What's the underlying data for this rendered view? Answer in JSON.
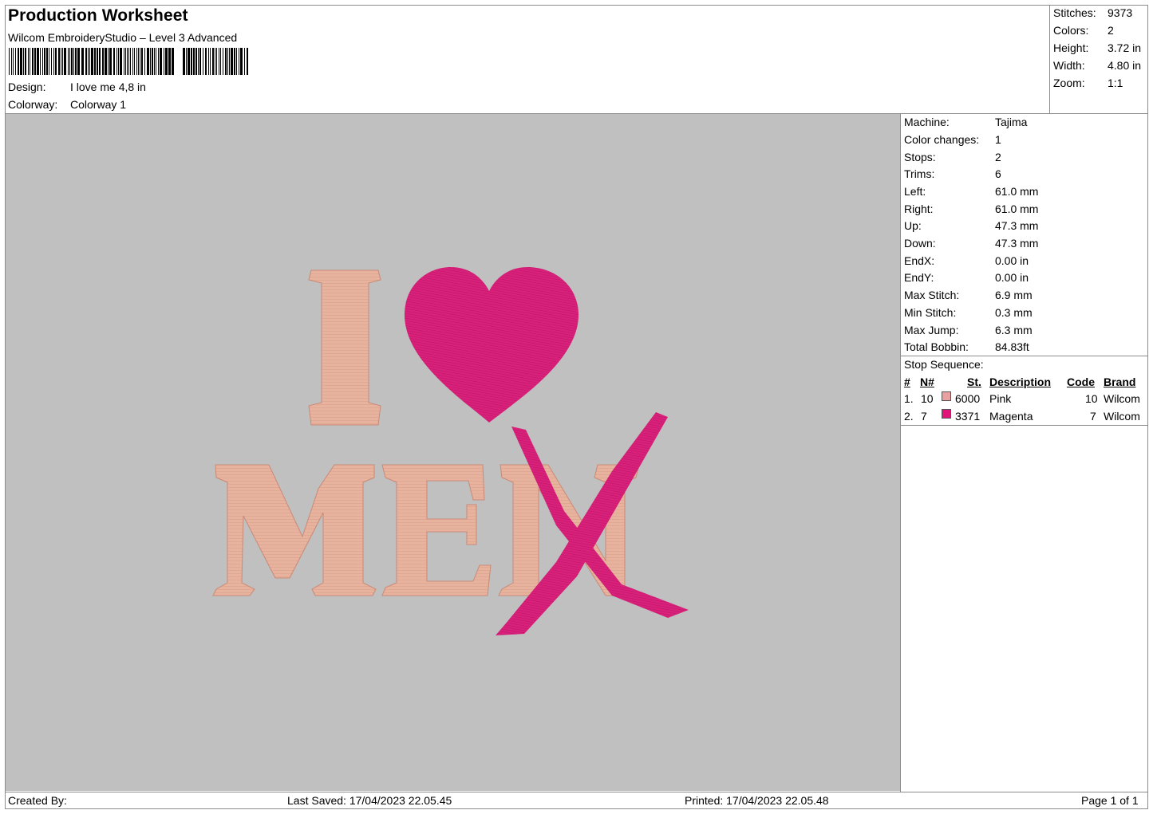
{
  "header": {
    "title": "Production Worksheet",
    "subtitle": "Wilcom EmbroideryStudio – Level 3 Advanced",
    "design_label": "Design:",
    "design_value": "I love me 4,8 in",
    "colorway_label": "Colorway:",
    "colorway_value": "Colorway 1"
  },
  "stats": [
    {
      "label": "Stitches:",
      "value": "9373"
    },
    {
      "label": "Colors:",
      "value": "2"
    },
    {
      "label": "Height:",
      "value": "3.72 in"
    },
    {
      "label": "Width:",
      "value": "4.80 in"
    },
    {
      "label": "Zoom:",
      "value": "1:1"
    }
  ],
  "machine_info": [
    {
      "label": "Machine:",
      "value": "Tajima"
    },
    {
      "label": "Color changes:",
      "value": "1"
    },
    {
      "label": "Stops:",
      "value": "2"
    },
    {
      "label": "Trims:",
      "value": "6"
    },
    {
      "label": "Left:",
      "value": "61.0 mm"
    },
    {
      "label": "Right:",
      "value": "61.0 mm"
    },
    {
      "label": "Up:",
      "value": "47.3 mm"
    },
    {
      "label": "Down:",
      "value": "47.3 mm"
    },
    {
      "label": "EndX:",
      "value": "0.00 in"
    },
    {
      "label": "EndY:",
      "value": "0.00 in"
    },
    {
      "label": "Max Stitch:",
      "value": "6.9 mm"
    },
    {
      "label": "Min Stitch:",
      "value": "0.3 mm"
    },
    {
      "label": "Max Jump:",
      "value": "6.3 mm"
    },
    {
      "label": "Total Bobbin:",
      "value": "84.83ft"
    }
  ],
  "stop_sequence": {
    "title": "Stop Sequence:",
    "headers": {
      "num": "#",
      "n": "N#",
      "st": "St.",
      "description": "Description",
      "code": "Code",
      "brand": "Brand"
    },
    "rows": [
      {
        "num": "1.",
        "n": "10",
        "color": "#e8a0a0",
        "st": "6000",
        "description": "Pink",
        "code": "10",
        "brand": "Wilcom"
      },
      {
        "num": "2.",
        "n": "7",
        "color": "#e0157a",
        "st": "3371",
        "description": "Magenta",
        "code": "7",
        "brand": "Wilcom"
      }
    ]
  },
  "design": {
    "text_top": "I",
    "text_bottom": "MEN",
    "thread_pink": "#e8b2a0",
    "thread_magenta": "#d8217a",
    "background": "#c0c0c0"
  },
  "footer": {
    "created_by": "Created By:",
    "last_saved": "Last Saved: 17/04/2023 22.05.45",
    "printed": "Printed: 17/04/2023 22.05.48",
    "page": "Page 1 of 1"
  }
}
